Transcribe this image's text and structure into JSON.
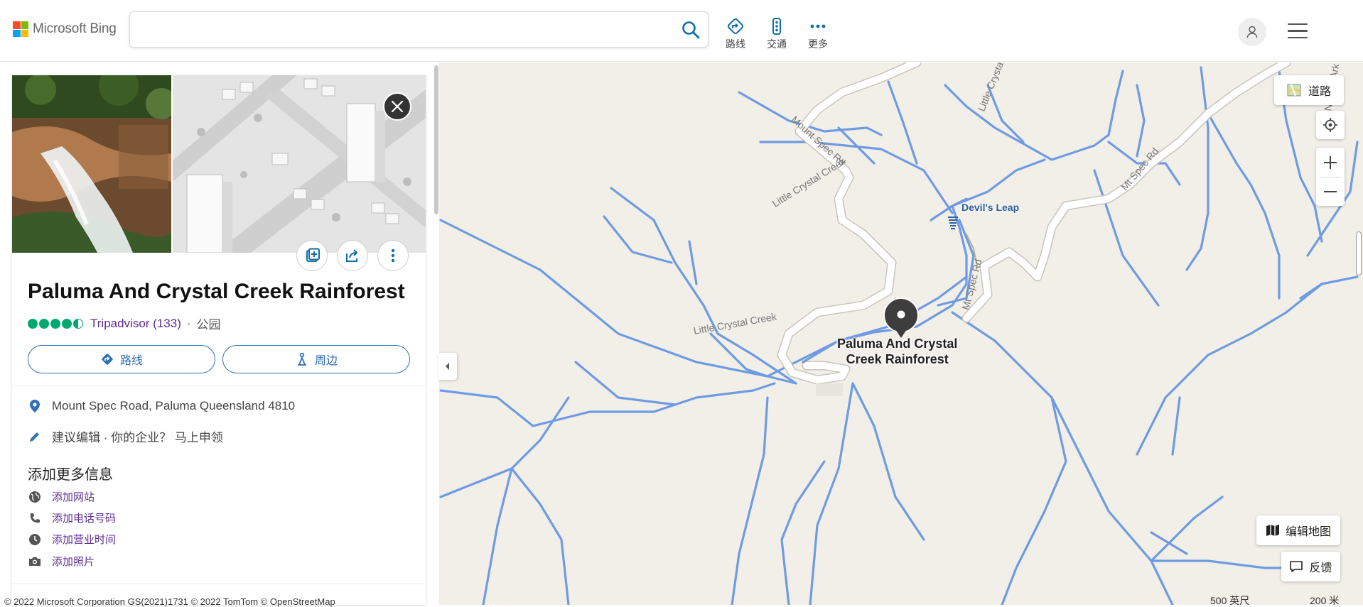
{
  "header": {
    "brand": "Microsoft Bing",
    "logo_colors": [
      "#f25022",
      "#7fba00",
      "#00a4ef",
      "#ffb900"
    ],
    "search": {
      "value": "",
      "placeholder": ""
    },
    "nav": [
      {
        "label": "路线",
        "icon": "directions-icon"
      },
      {
        "label": "交通",
        "icon": "traffic-icon"
      },
      {
        "label": "更多",
        "icon": "more-icon"
      }
    ],
    "accent": "#0e6da5"
  },
  "panel": {
    "title": "Paluma And Crystal Creek Rainforest",
    "rating": {
      "value": 4.5,
      "max": 5,
      "source": "Tripadvisor (133)",
      "color": "#00aa6c"
    },
    "separator": "·",
    "category": "公园",
    "buttons": {
      "directions": "路线",
      "nearby": "周边"
    },
    "address": "Mount Spec Road, Paluma Queensland 4810",
    "edit": "建议编辑 · 你的企业？ 马上申领",
    "add_more": {
      "heading": "添加更多信息",
      "items": [
        "添加网站",
        "添加电话号码",
        "添加营业时间",
        "添加照片"
      ]
    }
  },
  "map": {
    "road_style": "道路",
    "edit_map": "编辑地图",
    "feedback": "反馈",
    "scale": {
      "imperial": "500 英尺",
      "metric": "200 米"
    },
    "poi": {
      "line1": "Paluma And Crystal",
      "line2": "Creek Rainforest"
    },
    "waterfall": "Devil's Leap",
    "labels": {
      "mount_spec_rd": "Mount Spec Rd",
      "mt_spec_rd_right": "Mt Spec Rd",
      "mt_spec_rd_low": "Mt Spec Rd",
      "little_crystal_upper": "Little Crystal Creek",
      "little_crystal_lower": "Little Crystal Creek",
      "little_crystal_top": "Little Crystal Creek",
      "noahs_ark": "Noah's Ark Creek"
    },
    "colors": {
      "land": "#f2efe9",
      "water": "#6f9be3",
      "road": "#ffffff",
      "pin": "#3d3d3d"
    }
  },
  "footer": "© 2022 Microsoft Corporation  GS(2021)1731  © 2022 TomTom  © OpenStreetMap"
}
